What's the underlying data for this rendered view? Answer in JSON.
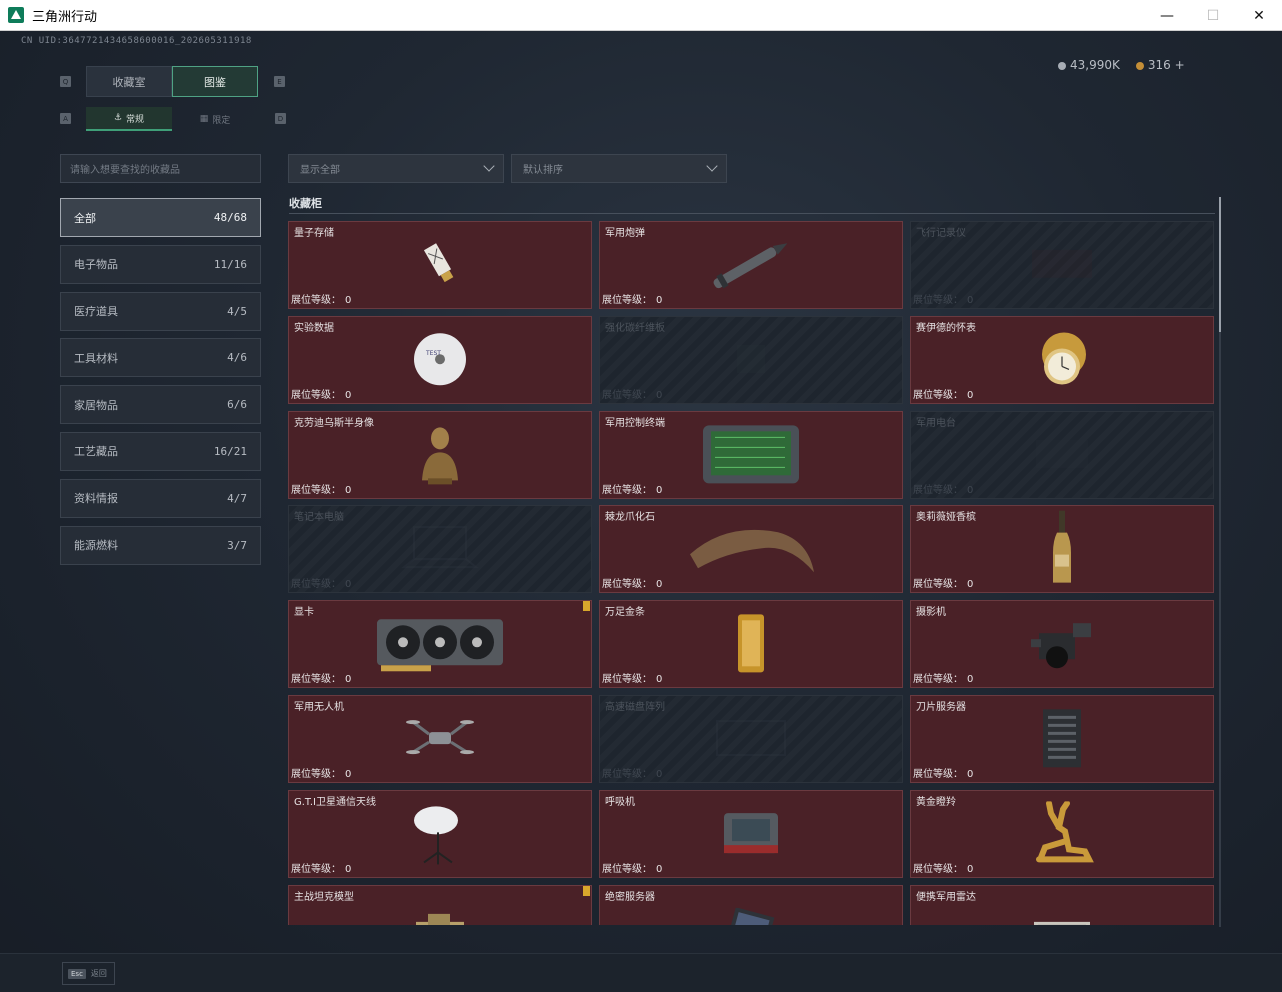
{
  "window": {
    "title": "三角洲行动",
    "controls": [
      "minimize",
      "maximize",
      "close"
    ]
  },
  "uid": "CN UID:3647721434658600016_202605311918",
  "currency": {
    "silver": "43,990K",
    "gold": "316",
    "add": "+"
  },
  "tabs": {
    "primary": [
      {
        "label": "收藏室",
        "active": false
      },
      {
        "label": "图鉴",
        "active": true
      }
    ],
    "secondary": [
      {
        "label": "常规",
        "active": true
      },
      {
        "label": "限定",
        "active": false
      }
    ],
    "key_hints": [
      "Q",
      "E",
      "A",
      "D"
    ]
  },
  "search": {
    "placeholder": "请输入想要查找的收藏品"
  },
  "categories": [
    {
      "label": "全部",
      "count": "48/68",
      "active": true
    },
    {
      "label": "电子物品",
      "count": "11/16"
    },
    {
      "label": "医疗道具",
      "count": "4/5"
    },
    {
      "label": "工具材料",
      "count": "4/6"
    },
    {
      "label": "家居物品",
      "count": "6/6"
    },
    {
      "label": "工艺藏品",
      "count": "16/21"
    },
    {
      "label": "资料情报",
      "count": "4/7"
    },
    {
      "label": "能源燃料",
      "count": "3/7"
    }
  ],
  "filters": {
    "display": "显示全部",
    "sort": "默认排序"
  },
  "section": {
    "title": "收藏柜"
  },
  "level_label": "展位等级：",
  "items": [
    {
      "name": "量子存储",
      "level": "0",
      "collected": true,
      "icon": "usb-drive-icon"
    },
    {
      "name": "军用炮弹",
      "level": "0",
      "collected": true,
      "icon": "artillery-shell-icon"
    },
    {
      "name": "飞行记录仪",
      "level": "0",
      "collected": false,
      "icon": "flight-recorder-icon"
    },
    {
      "name": "实验数据",
      "level": "0",
      "collected": true,
      "icon": "disc-icon"
    },
    {
      "name": "强化碳纤维板",
      "level": "0",
      "collected": false,
      "icon": "carbon-plate-icon"
    },
    {
      "name": "赛伊德的怀表",
      "level": "0",
      "collected": true,
      "icon": "pocket-watch-icon"
    },
    {
      "name": "克劳迪乌斯半身像",
      "level": "0",
      "collected": true,
      "icon": "bust-statue-icon"
    },
    {
      "name": "军用控制终端",
      "level": "0",
      "collected": true,
      "icon": "control-terminal-icon"
    },
    {
      "name": "军用电台",
      "level": "0",
      "collected": false,
      "icon": "radio-icon"
    },
    {
      "name": "笔记本电脑",
      "level": "0",
      "collected": false,
      "icon": "laptop-icon"
    },
    {
      "name": "棘龙爪化石",
      "level": "0",
      "collected": true,
      "icon": "claw-fossil-icon"
    },
    {
      "name": "奥莉薇娅香槟",
      "level": "0",
      "collected": true,
      "icon": "champagne-icon"
    },
    {
      "name": "显卡",
      "level": "0",
      "collected": true,
      "flag": true,
      "icon": "graphics-card-icon"
    },
    {
      "name": "万足金条",
      "level": "0",
      "collected": true,
      "icon": "gold-bar-icon"
    },
    {
      "name": "摄影机",
      "level": "0",
      "collected": true,
      "icon": "camera-icon"
    },
    {
      "name": "军用无人机",
      "level": "0",
      "collected": true,
      "icon": "drone-icon"
    },
    {
      "name": "高速磁盘阵列",
      "level": "0",
      "collected": false,
      "icon": "disk-array-icon"
    },
    {
      "name": "刀片服务器",
      "level": "0",
      "collected": true,
      "icon": "blade-server-icon"
    },
    {
      "name": "G.T.I卫星通信天线",
      "level": "0",
      "collected": true,
      "icon": "satellite-dish-icon"
    },
    {
      "name": "呼吸机",
      "level": "0",
      "collected": true,
      "icon": "ventilator-icon"
    },
    {
      "name": "黄金瞪羚",
      "level": "0",
      "collected": true,
      "icon": "gold-gazelle-icon"
    },
    {
      "name": "主战坦克模型",
      "level": "",
      "collected": true,
      "flag": true,
      "icon": "tank-model-icon"
    },
    {
      "name": "绝密服务器",
      "level": "",
      "collected": true,
      "icon": "secret-server-icon"
    },
    {
      "name": "便携军用雷达",
      "level": "",
      "collected": true,
      "icon": "portable-radar-icon"
    }
  ],
  "bottom": {
    "esc_key": "Esc",
    "esc_label": "返回"
  }
}
